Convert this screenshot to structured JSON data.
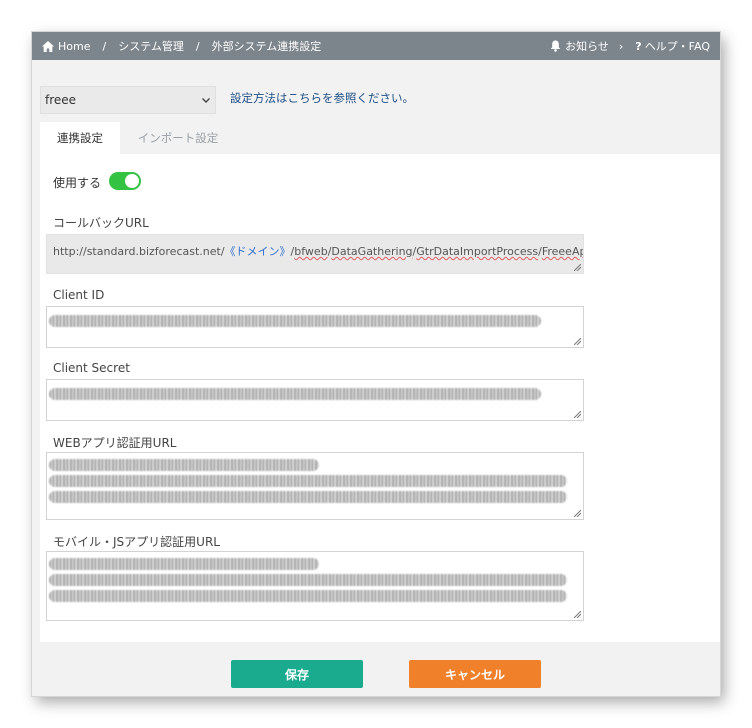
{
  "breadcrumb": {
    "home": "Home",
    "separator": "/",
    "system_admin": "システム管理",
    "external_link": "外部システム連携設定"
  },
  "header_right": {
    "notice": "お知らせ",
    "chevron": "›",
    "help": "ヘルプ・FAQ",
    "help_prefix": "?"
  },
  "connector_select": {
    "value": "freee"
  },
  "help_link": "設定方法はこちらを参照ください。",
  "tabs": [
    {
      "label": "連携設定",
      "active": true
    },
    {
      "label": "インポート設定",
      "active": false
    }
  ],
  "form": {
    "use_label": "使用する",
    "use_enabled": true,
    "callback_label": "コールバックURL",
    "callback_url": {
      "prefix": "http://standard.bizforecast.net/",
      "domain": "《ドメイン》",
      "suffix_parts": [
        "/",
        "bfweb",
        "/",
        "DataGathering",
        "/",
        "GtrDataImportProcess",
        "/",
        "FreeeApiLinkage"
      ]
    },
    "client_id_label": "Client ID",
    "client_secret_label": "Client Secret",
    "web_url_label": "WEBアプリ認証用URL",
    "mobile_url_label": "モバイル・JSアプリ認証用URL"
  },
  "buttons": {
    "save": "保存",
    "cancel": "キャンセル"
  },
  "colors": {
    "topbar": "#7d858c",
    "toggle_on": "#34c242",
    "save": "#1aab8f",
    "cancel": "#f0802a",
    "link": "#1d4f86",
    "domain_token": "#2f6fd1"
  },
  "icons": {
    "home": "home-icon",
    "bell": "bell-icon",
    "select_arrow": "chevron-down-icon"
  }
}
